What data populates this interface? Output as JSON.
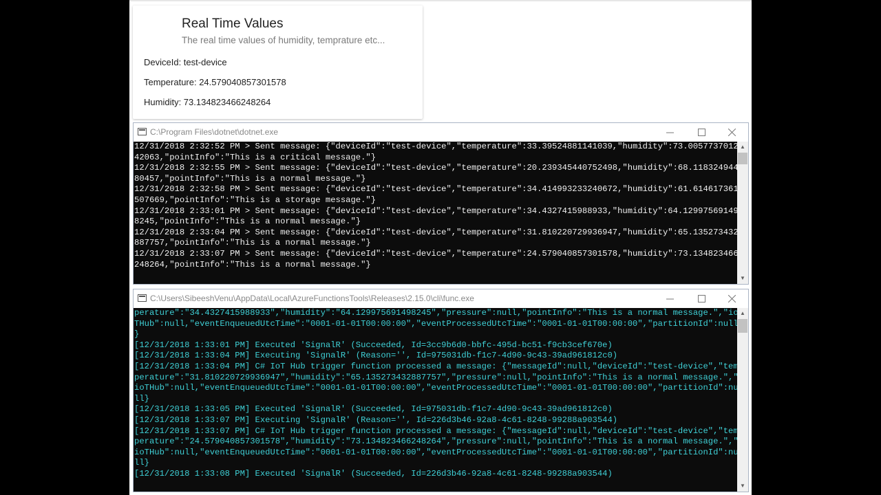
{
  "card": {
    "title": "Real Time Values",
    "subtitle": "The real time values of humidity, temprature etc...",
    "device_line": "DeviceId: test-device",
    "temperature_line": "Temperature: 24.579040857301578",
    "humidity_line": "Humidity: 73.134823466248264"
  },
  "window1": {
    "title": "C:\\Program Files\\dotnet\\dotnet.exe",
    "lines": [
      "12/31/2018 2:32:52 PM > Sent message: {\"deviceId\":\"test-device\",\"temperature\":33.39524881141039,\"humidity\":73.0057737012",
      "42063,\"pointInfo\":\"This is a critical message.\"}",
      "12/31/2018 2:32:55 PM > Sent message: {\"deviceId\":\"test-device\",\"temperature\":20.239345440752498,\"humidity\":68.118324944",
      "80457,\"pointInfo\":\"This is a normal message.\"}",
      "12/31/2018 2:32:58 PM > Sent message: {\"deviceId\":\"test-device\",\"temperature\":34.414993233240672,\"humidity\":61.614617361",
      "507669,\"pointInfo\":\"This is a storage message.\"}",
      "12/31/2018 2:33:01 PM > Sent message: {\"deviceId\":\"test-device\",\"temperature\":34.4327415988933,\"humidity\":64.12997569149",
      "8245,\"pointInfo\":\"This is a normal message.\"}",
      "12/31/2018 2:33:04 PM > Sent message: {\"deviceId\":\"test-device\",\"temperature\":31.810220729936947,\"humidity\":65.135273432",
      "887757,\"pointInfo\":\"This is a normal message.\"}",
      "12/31/2018 2:33:07 PM > Sent message: {\"deviceId\":\"test-device\",\"temperature\":24.579040857301578,\"humidity\":73.134823466",
      "248264,\"pointInfo\":\"This is a normal message.\"}"
    ]
  },
  "window2": {
    "title": "C:\\Users\\SibeeshVenu\\AppData\\Local\\AzureFunctionsTools\\Releases\\2.15.0\\cli\\func.exe",
    "lines": [
      "perature\":\"34.4327415988933\",\"humidity\":\"64.129975691498245\",\"pressure\":null,\"pointInfo\":\"This is a normal message.\",\"io",
      "THub\":null,\"eventEnqueuedUtcTime\":\"0001-01-01T00:00:00\",\"eventProcessedUtcTime\":\"0001-01-01T00:00:00\",\"partitionId\":null",
      "}",
      "[12/31/2018 1:33:01 PM] Executed 'SignalR' (Succeeded, Id=3cc9b6d0-bbfc-495d-bc51-f9cb3cef670e)",
      "[12/31/2018 1:33:04 PM] Executing 'SignalR' (Reason='', Id=975031db-f1c7-4d90-9c43-39ad961812c0)",
      "[12/31/2018 1:33:04 PM] C# IoT Hub trigger function processed a message: {\"messageId\":null,\"deviceId\":\"test-device\",\"tem",
      "perature\":\"31.810220729936947\",\"humidity\":\"65.135273432887757\",\"pressure\":null,\"pointInfo\":\"This is a normal message.\",\"",
      "ioTHub\":null,\"eventEnqueuedUtcTime\":\"0001-01-01T00:00:00\",\"eventProcessedUtcTime\":\"0001-01-01T00:00:00\",\"partitionId\":nu",
      "ll}",
      "[12/31/2018 1:33:05 PM] Executed 'SignalR' (Succeeded, Id=975031db-f1c7-4d90-9c43-39ad961812c0)",
      "[12/31/2018 1:33:07 PM] Executing 'SignalR' (Reason='', Id=226d3b46-92a8-4c61-8248-99288a903544)",
      "[12/31/2018 1:33:07 PM] C# IoT Hub trigger function processed a message: {\"messageId\":null,\"deviceId\":\"test-device\",\"tem",
      "perature\":\"24.579040857301578\",\"humidity\":\"73.134823466248264\",\"pressure\":null,\"pointInfo\":\"This is a normal message.\",\"",
      "ioTHub\":null,\"eventEnqueuedUtcTime\":\"0001-01-01T00:00:00\",\"eventProcessedUtcTime\":\"0001-01-01T00:00:00\",\"partitionId\":nu",
      "ll}",
      "[12/31/2018 1:33:08 PM] Executed 'SignalR' (Succeeded, Id=226d3b46-92a8-4c61-8248-99288a903544)"
    ]
  }
}
